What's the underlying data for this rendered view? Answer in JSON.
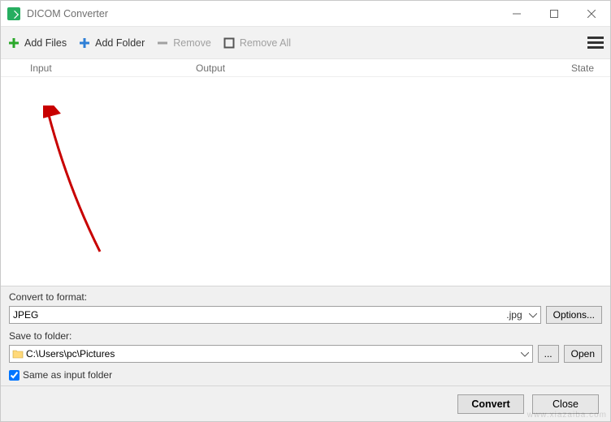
{
  "window": {
    "title": "DICOM Converter"
  },
  "toolbar": {
    "add_files": "Add Files",
    "add_folder": "Add Folder",
    "remove": "Remove",
    "remove_all": "Remove All"
  },
  "columns": {
    "input": "Input",
    "output": "Output",
    "state": "State"
  },
  "convert": {
    "label": "Convert to format:",
    "format_name": "JPEG",
    "format_ext": ".jpg",
    "options_label": "Options..."
  },
  "save": {
    "label": "Save to folder:",
    "path": "C:\\Users\\pc\\Pictures",
    "browse": "...",
    "open": "Open",
    "same_as_input": "Same as input folder"
  },
  "footer": {
    "convert": "Convert",
    "close": "Close"
  }
}
